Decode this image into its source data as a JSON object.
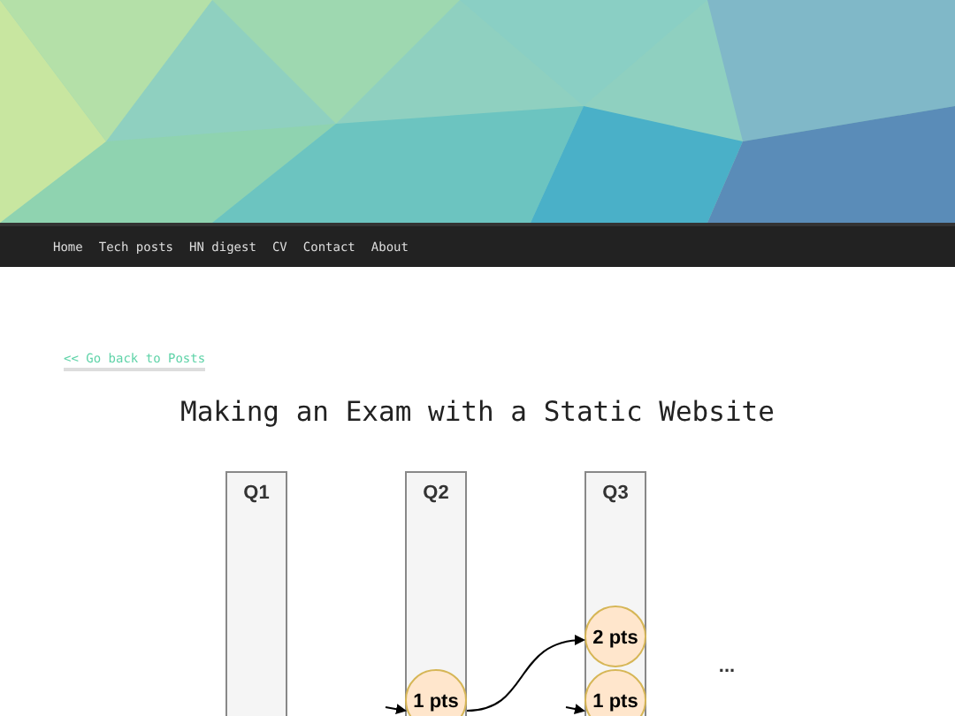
{
  "nav": {
    "items": [
      "Home",
      "Tech posts",
      "HN digest",
      "CV",
      "Contact",
      "About"
    ]
  },
  "back_link": "<< Go back to Posts",
  "title": "Making an Exam with a Static Website",
  "diagram": {
    "columns": [
      {
        "label": "Q1"
      },
      {
        "label": "Q2",
        "nodes": [
          "1 pts"
        ]
      },
      {
        "label": "Q3",
        "nodes": [
          "2 pts",
          "1 pts"
        ]
      }
    ],
    "more": "..."
  }
}
